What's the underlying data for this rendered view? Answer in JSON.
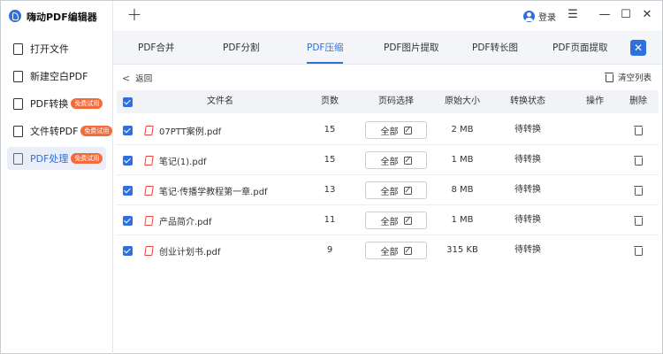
{
  "app": {
    "title": "嗨动PDF编辑器"
  },
  "titlebar": {
    "login_label": "登录",
    "menu_icon": "☰",
    "minimize_icon": "—",
    "maximize_icon": "☐",
    "close_icon": "✕",
    "new_tab_icon": "+"
  },
  "sidebar": {
    "items": [
      {
        "label": "打开文件",
        "badge": "",
        "active": false
      },
      {
        "label": "新建空白PDF",
        "badge": "",
        "active": false
      },
      {
        "label": "PDF转换",
        "badge": "免费试用",
        "active": false
      },
      {
        "label": "文件转PDF",
        "badge": "免费试用",
        "active": false
      },
      {
        "label": "PDF处理",
        "badge": "免费试用",
        "active": true
      }
    ]
  },
  "tabs": [
    {
      "label": "PDF合并",
      "active": false
    },
    {
      "label": "PDF分割",
      "active": false
    },
    {
      "label": "PDF压缩",
      "active": true
    },
    {
      "label": "PDF图片提取",
      "active": false
    },
    {
      "label": "PDF转长图",
      "active": false
    },
    {
      "label": "PDF页面提取",
      "active": false
    }
  ],
  "toolbar": {
    "back_label": "返回",
    "back_icon": "<",
    "clear_label": "清空列表"
  },
  "table": {
    "columns": [
      "文件名",
      "页数",
      "页码选择",
      "原始大小",
      "转换状态",
      "操作",
      "删除"
    ],
    "rows": [
      {
        "name": "07PTT案例.pdf",
        "pages": "15",
        "page_select": "全部",
        "size": "2 MB",
        "status": "待转换"
      },
      {
        "name": "笔记(1).pdf",
        "pages": "15",
        "page_select": "全部",
        "size": "1 MB",
        "status": "待转换"
      },
      {
        "name": "笔记·传播学教程第一章.pdf",
        "pages": "13",
        "page_select": "全部",
        "size": "8 MB",
        "status": "待转换"
      },
      {
        "name": "产品简介.pdf",
        "pages": "11",
        "page_select": "全部",
        "size": "1 MB",
        "status": "待转换"
      },
      {
        "name": "创业计划书.pdf",
        "pages": "9",
        "page_select": "全部",
        "size": "315 KB",
        "status": "待转换"
      }
    ]
  },
  "colors": {
    "accent": "#2f6fde",
    "badge": "#f26b3a",
    "pdf_red": "#e0473d"
  }
}
